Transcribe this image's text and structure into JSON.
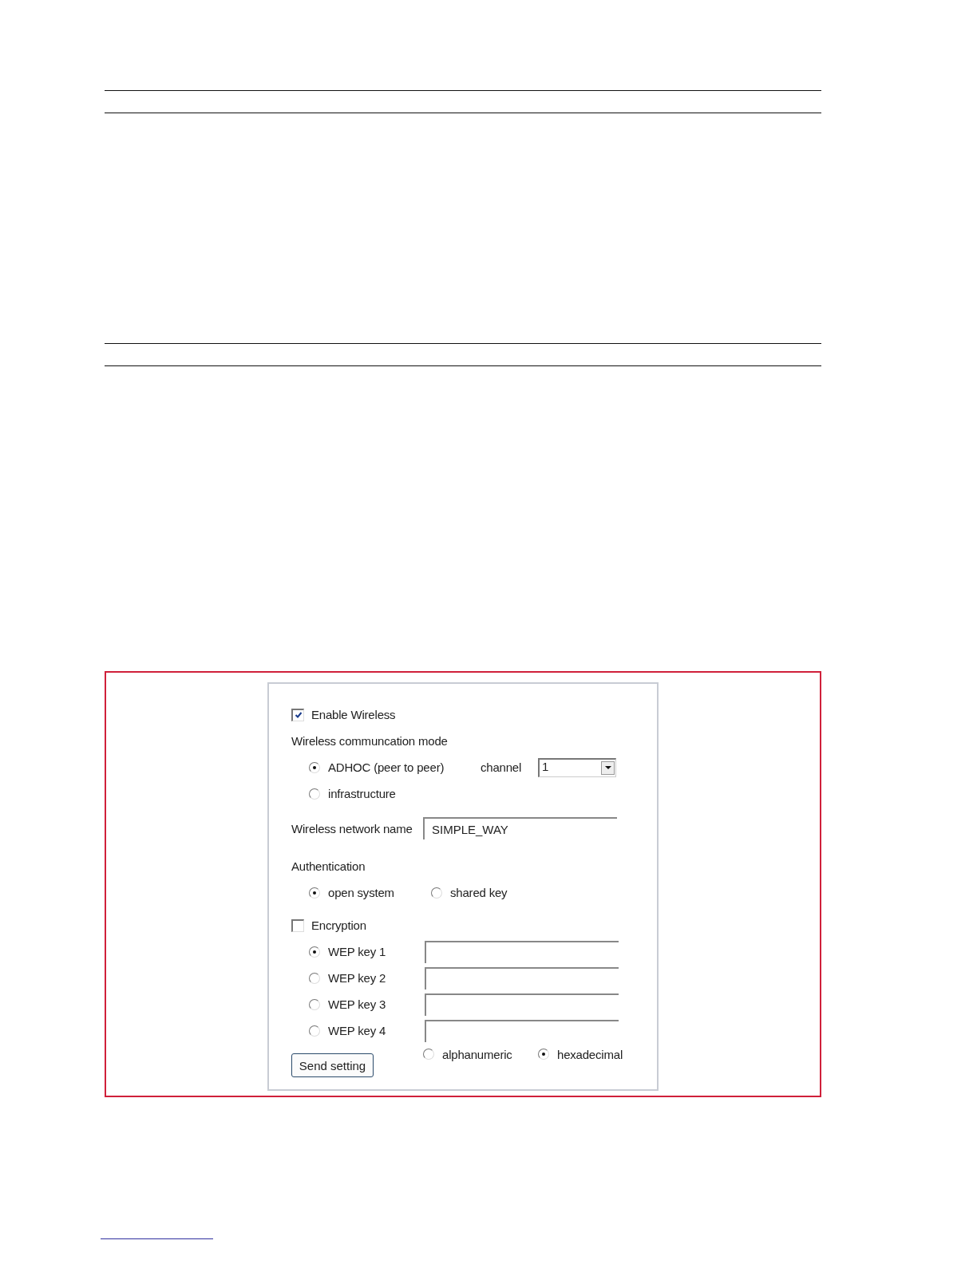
{
  "enable_wireless": {
    "label": "Enable Wireless",
    "checked": true
  },
  "mode": {
    "label": "Wireless communcation mode",
    "options": [
      {
        "label": "ADHOC (peer to peer)",
        "selected": true
      },
      {
        "label": "infrastructure",
        "selected": false
      }
    ],
    "channel": {
      "label": "channel",
      "value": "1"
    }
  },
  "network_name": {
    "label": "Wireless network name",
    "value": "SIMPLE_WAY"
  },
  "authentication": {
    "label": "Authentication",
    "options": [
      {
        "label": "open system",
        "selected": true
      },
      {
        "label": "shared key",
        "selected": false
      }
    ]
  },
  "encryption": {
    "label": "Encryption",
    "checked": false
  },
  "wep_keys": [
    {
      "label": "WEP key 1",
      "selected": true
    },
    {
      "label": "WEP key 2",
      "selected": false
    },
    {
      "label": "WEP key 3",
      "selected": false
    },
    {
      "label": "WEP key 4",
      "selected": false
    }
  ],
  "key_format": [
    {
      "label": "alphanumeric",
      "selected": false
    },
    {
      "label": "hexadecimal",
      "selected": true
    }
  ],
  "buttons": [
    {
      "label": "Send setting"
    }
  ]
}
